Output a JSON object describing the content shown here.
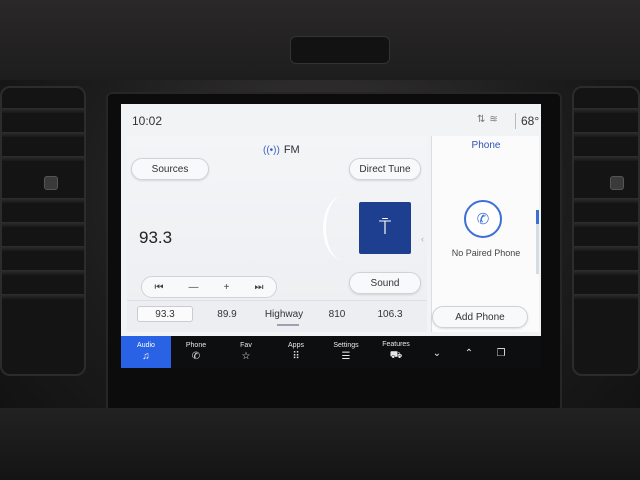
{
  "status": {
    "time": "10:02",
    "temperature": "68°",
    "icons": [
      "transfer-icon",
      "wifi-icon"
    ]
  },
  "radio": {
    "band": "FM",
    "frequency": "93.3",
    "sources_label": "Sources",
    "direct_tune_label": "Direct Tune",
    "sound_label": "Sound",
    "transport": {
      "prev": "⏮",
      "minus": "—",
      "plus": "+",
      "next": "⏭"
    },
    "presets": [
      "93.3",
      "89.9",
      "Highway",
      "810",
      "106.3"
    ]
  },
  "phone": {
    "title": "Phone",
    "status": "No Paired Phone",
    "add_label": "Add Phone"
  },
  "nav": [
    {
      "label": "Audio",
      "icon": "music-note-icon",
      "glyph": "♫",
      "active": true
    },
    {
      "label": "Phone",
      "icon": "phone-icon",
      "glyph": "✆",
      "active": false
    },
    {
      "label": "Fav",
      "icon": "star-icon",
      "glyph": "☆",
      "active": false
    },
    {
      "label": "Apps",
      "icon": "grid-icon",
      "glyph": "⠿",
      "active": false
    },
    {
      "label": "Settings",
      "icon": "sliders-icon",
      "glyph": "☰",
      "active": false
    },
    {
      "label": "Features",
      "icon": "car-icon",
      "glyph": "⛟",
      "active": false
    }
  ],
  "colors": {
    "accent": "#2a62e6",
    "station_art": "#1e3f8f",
    "nav_bg": "#0d0e10"
  }
}
